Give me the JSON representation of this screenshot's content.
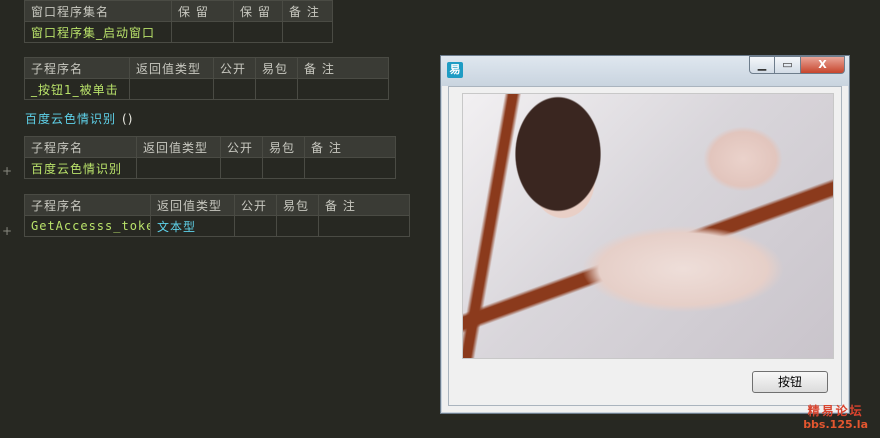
{
  "colors": {
    "background": "#272822",
    "header_cell": "#3a3b35",
    "identifier": "#b9e26a",
    "type_name": "#5fd2ea"
  },
  "table1": {
    "headers": [
      "窗口程序集名",
      "保 留",
      "保 留",
      "备 注"
    ],
    "row": [
      "窗口程序集_启动窗口",
      "",
      "",
      ""
    ]
  },
  "table2": {
    "headers": [
      "子程序名",
      "返回值类型",
      "公开",
      "易包",
      "备 注"
    ],
    "row": [
      "_按钮1_被单击",
      "",
      "",
      "",
      ""
    ]
  },
  "call_line": {
    "name": "百度云色情识别",
    "parens": "()"
  },
  "table3": {
    "plus": "+",
    "headers": [
      "子程序名",
      "返回值类型",
      "公开",
      "易包",
      "备 注"
    ],
    "row": [
      "百度云色情识别",
      "",
      "",
      "",
      ""
    ]
  },
  "table4": {
    "plus": "+",
    "headers": [
      "子程序名",
      "返回值类型",
      "公开",
      "易包",
      "备 注"
    ],
    "row": [
      "GetAccesss_token",
      "文本型",
      "",
      "",
      ""
    ]
  },
  "window": {
    "icon": "易",
    "min_label": "▁",
    "max_label": "▭",
    "close_label": "X",
    "button_label": "按钮"
  },
  "watermark": {
    "line1": "精易论坛",
    "line2": "bbs.125.la"
  }
}
